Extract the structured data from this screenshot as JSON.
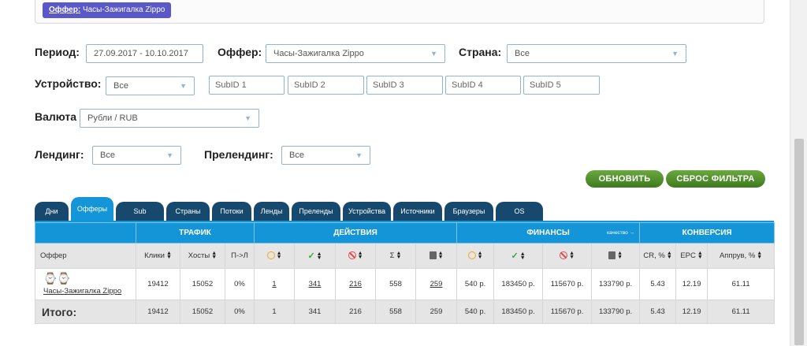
{
  "header": {
    "offer_label": "Оффер:",
    "offer_value": "Часы-Зажигалка Zippo"
  },
  "filters": {
    "period_label": "Период:",
    "period_value": "27.09.2017 - 10.10.2017",
    "offer_label": "Оффер:",
    "offer_value": "Часы-Зажигалка Zippo",
    "country_label": "Страна:",
    "country_value": "Все",
    "device_label": "Устройство:",
    "device_value": "Все",
    "subids": [
      "SubID 1",
      "SubID 2",
      "SubID 3",
      "SubID 4",
      "SubID 5"
    ],
    "currency_label": "Валюта",
    "currency_value": "Рубли / RUB",
    "landing_label": "Лендинг:",
    "landing_value": "Все",
    "prelanding_label": "Прелендинг:",
    "prelanding_value": "Все"
  },
  "buttons": {
    "refresh": "ОБНОВИТЬ",
    "reset": "СБРОС ФИЛЬТРА"
  },
  "tabs": [
    "Дни",
    "Офферы",
    "Sub",
    "Страны",
    "Потоки",
    "Ленды",
    "Преленды",
    "Устройства",
    "Источники",
    "Браузеры",
    "OS"
  ],
  "active_tab": "Офферы",
  "groups": {
    "traffic": "ТРАФИК",
    "actions": "ДЕЙСТВИЯ",
    "finance": "ФИНАНСЫ",
    "quality": "качество →",
    "conversion": "КОНВЕРСИЯ"
  },
  "columns": {
    "offer": "Оффер",
    "clicks": "Клики",
    "hosts": "Хосты",
    "pl": "П->Л",
    "sum": "Σ",
    "cr": "CR, %",
    "epc": "EPC",
    "approve": "Аппрув, %"
  },
  "icons": [
    "clock-icon",
    "check-icon",
    "ban-icon",
    "trash-icon"
  ],
  "rows": [
    {
      "offer": "Часы-Зажигалка Zippo",
      "clicks": "19412",
      "hosts": "15052",
      "pl": "0%",
      "wait": "1",
      "approved": "341",
      "declined": "216",
      "sum": "558",
      "trash": "259",
      "fin_wait": "540 р.",
      "fin_approved": "183450 р.",
      "fin_declined": "115670 р.",
      "fin_trash": "133790 р.",
      "cr": "5.43",
      "epc": "12.19",
      "approve": "61.11"
    }
  ],
  "total": {
    "label": "Итого:",
    "clicks": "19412",
    "hosts": "15052",
    "pl": "0%",
    "wait": "1",
    "approved": "341",
    "declined": "216",
    "sum": "558",
    "trash": "259",
    "fin_wait": "540 р.",
    "fin_approved": "183450 р.",
    "fin_declined": "115670 р.",
    "fin_trash": "133790 р.",
    "cr": "5.43",
    "epc": "12.19",
    "approve": "61.11"
  },
  "colors": {
    "accent": "#1495d7",
    "tab_dark": "#17496e",
    "button_green": "#4e8a2c",
    "chip": "#5a58c9"
  }
}
